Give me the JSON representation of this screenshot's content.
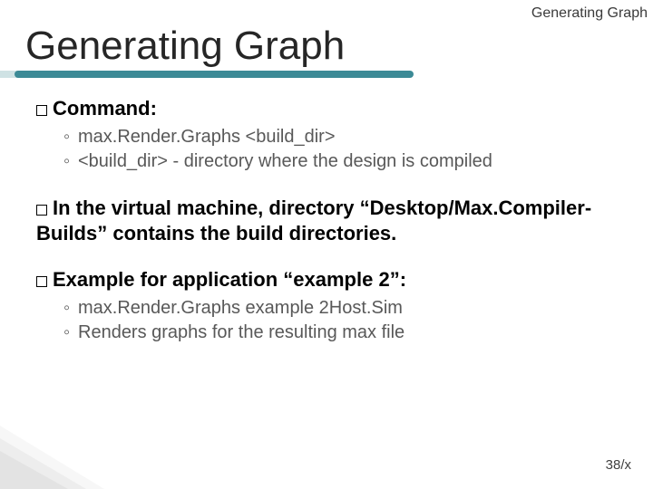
{
  "breadcrumb": "Generating Graph",
  "title": "Generating Graph",
  "section_command": {
    "heading_prefix": "Command",
    "heading_suffix": ":",
    "sub1": "max.Render.Graphs <build_dir>",
    "sub2": "<build_dir> - directory where the design is compiled"
  },
  "section_vm": {
    "prefix": "In",
    "rest": " the virtual machine, directory “Desktop/Max.Compiler-Builds” contains the build directories."
  },
  "section_example": {
    "prefix": "Example",
    "rest": " for application “example 2”:",
    "sub1": "max.Render.Graphs example 2Host.Sim",
    "sub2": "Renders graphs for the resulting max file"
  },
  "page_number": "38/x"
}
